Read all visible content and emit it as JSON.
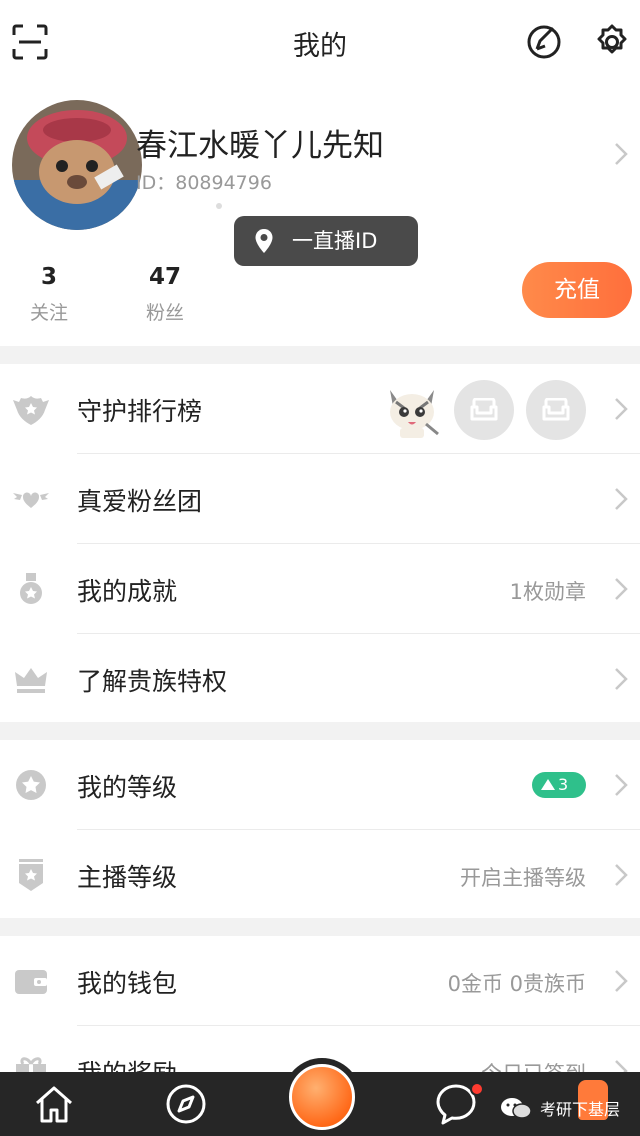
{
  "header": {
    "title": "我的"
  },
  "profile": {
    "name": "春江水暖丫儿先知",
    "id_text": "ID：80894796"
  },
  "tooltip": {
    "text": "一直播ID"
  },
  "stats": [
    {
      "value": "3",
      "label": "关注"
    },
    {
      "value": "47",
      "label": "粉丝"
    }
  ],
  "recharge_label": "充值",
  "menu_group1": [
    {
      "label": "守护排行榜",
      "icon": "shield-icon"
    },
    {
      "label": "真爱粉丝团",
      "icon": "heart-wings-icon"
    },
    {
      "label": "我的成就",
      "icon": "medal-icon",
      "value": "1枚勋章"
    },
    {
      "label": "了解贵族特权",
      "icon": "crown-icon"
    }
  ],
  "menu_group2": [
    {
      "label": "我的等级",
      "icon": "star-icon",
      "level": "3"
    },
    {
      "label": "主播等级",
      "icon": "badge-icon",
      "value": "开启主播等级"
    }
  ],
  "menu_group3": [
    {
      "label": "我的钱包",
      "icon": "wallet-icon",
      "value": "0金币 0贵族币"
    },
    {
      "label": "我的奖励",
      "icon": "gift-icon",
      "value": "今日已签到"
    }
  ],
  "watermark": "考研下基层",
  "colors": {
    "accent": "#ff7a3a",
    "level": "#2fc08b",
    "tabbar": "#262626"
  }
}
